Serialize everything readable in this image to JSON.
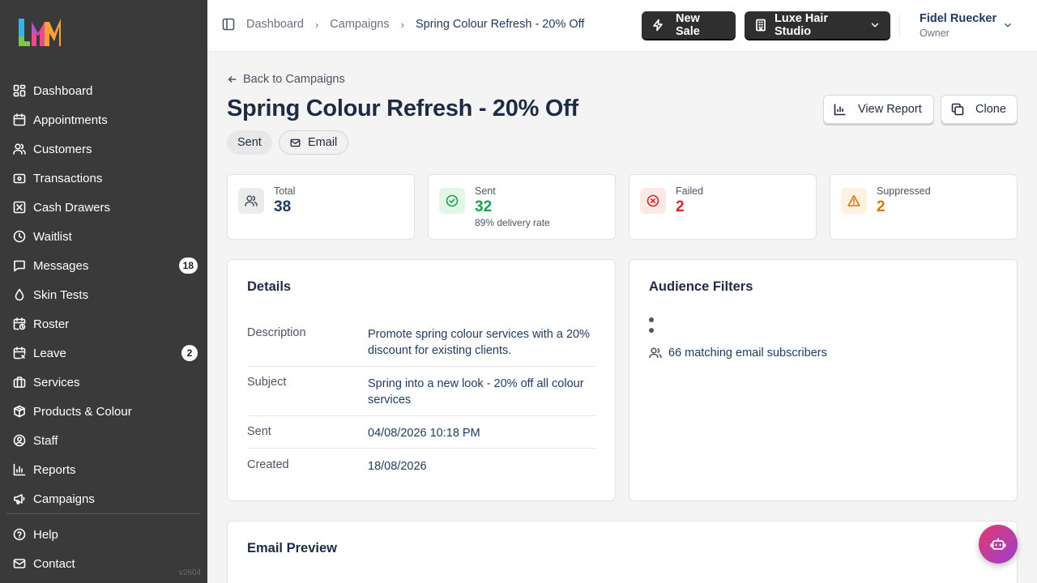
{
  "brand": {
    "logo_text": "LM",
    "version": "v2604"
  },
  "sidebar": {
    "items": [
      {
        "label": "Dashboard",
        "icon": "dashboard-icon"
      },
      {
        "label": "Appointments",
        "icon": "calendar-icon"
      },
      {
        "label": "Customers",
        "icon": "users-icon"
      },
      {
        "label": "Transactions",
        "icon": "wallet-icon"
      },
      {
        "label": "Cash Drawers",
        "icon": "cash-drawer-icon"
      },
      {
        "label": "Waitlist",
        "icon": "clock-icon"
      },
      {
        "label": "Messages",
        "icon": "message-icon",
        "badge": "18"
      },
      {
        "label": "Skin Tests",
        "icon": "droplet-icon"
      },
      {
        "label": "Roster",
        "icon": "calendar-clock-icon"
      },
      {
        "label": "Leave",
        "icon": "calendar-off-icon",
        "badge": "2"
      },
      {
        "label": "Services",
        "icon": "briefcase-icon"
      },
      {
        "label": "Products & Colour",
        "icon": "package-icon"
      },
      {
        "label": "Staff",
        "icon": "user-circle-icon"
      },
      {
        "label": "Reports",
        "icon": "bar-chart-icon"
      },
      {
        "label": "Campaigns",
        "icon": "megaphone-icon"
      }
    ],
    "bottom": [
      {
        "label": "Help",
        "icon": "help-icon"
      },
      {
        "label": "Contact",
        "icon": "mail-icon"
      }
    ]
  },
  "topbar": {
    "breadcrumbs": [
      "Dashboard",
      "Campaigns",
      "Spring Colour Refresh - 20% Off"
    ],
    "new_sale": "New Sale",
    "location": "Luxe Hair Studio",
    "user_name": "Fidel Ruecker",
    "user_role": "Owner"
  },
  "page": {
    "back": "Back to Campaigns",
    "title": "Spring Colour Refresh - 20% Off",
    "tags": [
      "Sent",
      "Email"
    ],
    "view_report": "View Report",
    "clone": "Clone"
  },
  "stats": [
    {
      "label": "Total",
      "value": "38",
      "sub": "",
      "color": "#1e3a5f",
      "bg": "#ececec",
      "icon": "users-icon"
    },
    {
      "label": "Sent",
      "value": "32",
      "sub": "89% delivery rate",
      "color": "#16a34a",
      "bg": "#e3f7e9",
      "icon": "check-circle-icon"
    },
    {
      "label": "Failed",
      "value": "2",
      "sub": "",
      "color": "#dc2626",
      "bg": "#fde8e8",
      "icon": "x-circle-icon"
    },
    {
      "label": "Suppressed",
      "value": "2",
      "sub": "",
      "color": "#d97706",
      "bg": "#fdf1e1",
      "icon": "alert-triangle-icon"
    }
  ],
  "details": {
    "title": "Details",
    "rows": [
      {
        "key": "Description",
        "value": "Promote spring colour services with a 20% discount for existing clients."
      },
      {
        "key": "Subject",
        "value": "Spring into a new look - 20% off all colour services"
      },
      {
        "key": "Sent",
        "value": "04/08/2026 10:18 PM"
      },
      {
        "key": "Created",
        "value": "18/08/2026"
      }
    ]
  },
  "audience": {
    "title": "Audience Filters",
    "matching": "66 matching email subscribers"
  },
  "email_preview": {
    "title": "Email Preview"
  }
}
